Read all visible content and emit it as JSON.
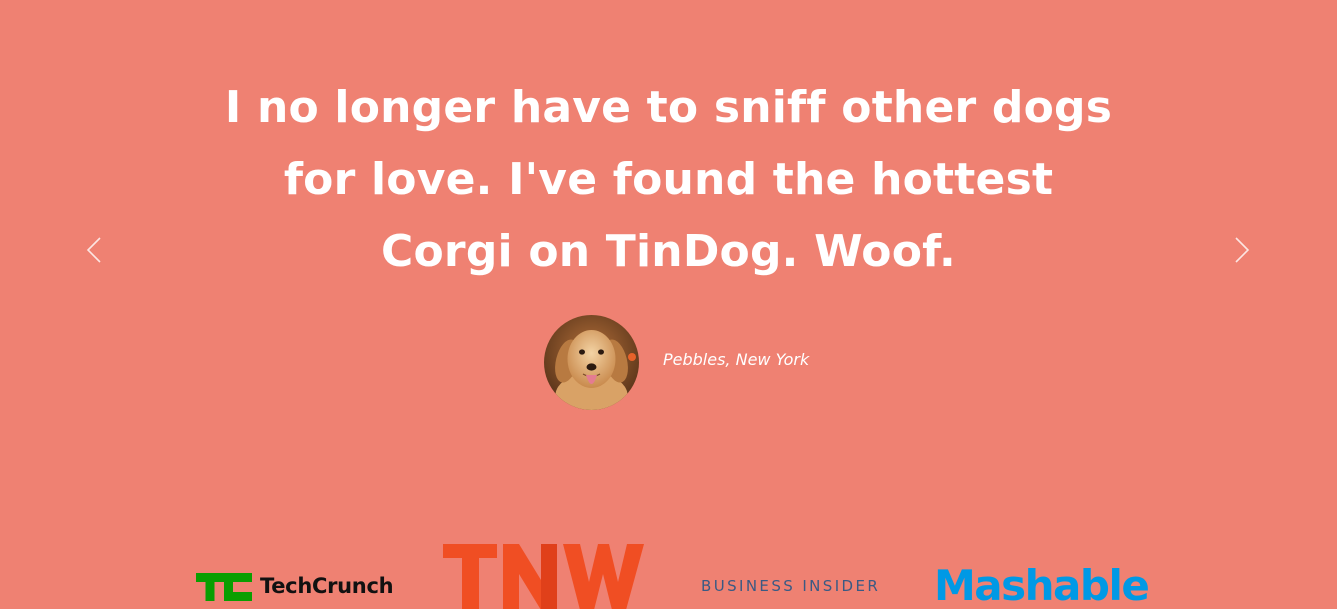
{
  "colors": {
    "background": "#EF8172",
    "text": "#FFFFFF",
    "techcrunch_green": "#0A9E01",
    "tnw_orange": "#F04E23",
    "business_insider": "#3A5A84",
    "mashable_blue": "#0099E5"
  },
  "testimonial": {
    "quote_lines": [
      "I no longer have to sniff other dogs",
      "for love. I've found the hottest",
      "Corgi on TinDog. Woof."
    ],
    "author": "Pebbles, New York",
    "avatar_icon": "golden-retriever-photo"
  },
  "carousel": {
    "prev_icon": "chevron-left-icon",
    "next_icon": "chevron-right-icon"
  },
  "press": {
    "techcrunch": "TechCrunch",
    "tnw": "TNW",
    "business_insider": "BUSINESS INSIDER",
    "mashable": "Mashable"
  }
}
